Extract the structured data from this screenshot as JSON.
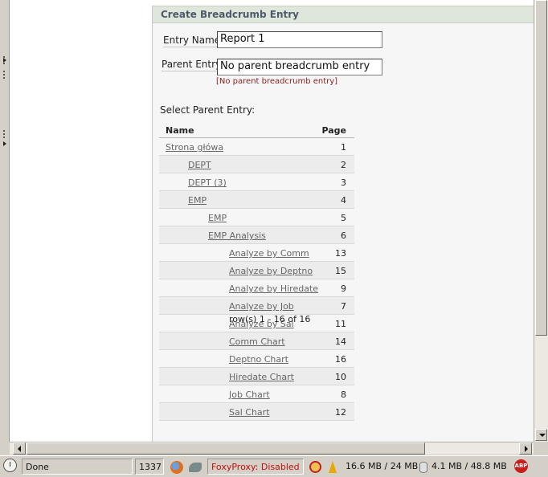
{
  "form": {
    "title": "Create Breadcrumb Entry",
    "entry_name": {
      "label": "Entry Name",
      "value": "Report 1"
    },
    "parent_entry": {
      "label": "Parent Entry",
      "value": "No parent breadcrumb entry",
      "note": "[No parent breadcrumb entry]"
    },
    "select_parent_label": "Select Parent Entry:"
  },
  "report": {
    "columns": [
      "Name",
      "Page"
    ],
    "rows": [
      {
        "name": "Strona główa",
        "page": "1",
        "level": 0
      },
      {
        "name": "DEPT",
        "page": "2",
        "level": 1
      },
      {
        "name": "DEPT (3)",
        "page": "3",
        "level": 1
      },
      {
        "name": "EMP",
        "page": "4",
        "level": 1
      },
      {
        "name": "EMP",
        "page": "5",
        "level": 2
      },
      {
        "name": "EMP Analysis",
        "page": "6",
        "level": 2
      },
      {
        "name": "Analyze by Comm",
        "page": "13",
        "level": 3
      },
      {
        "name": "Analyze by Deptno",
        "page": "15",
        "level": 3
      },
      {
        "name": "Analyze by Hiredate",
        "page": "9",
        "level": 3
      },
      {
        "name": "Analyze by Job",
        "page": "7",
        "level": 3
      },
      {
        "name": "Analyze by Sal",
        "page": "11",
        "level": 3
      },
      {
        "name": "Comm Chart",
        "page": "14",
        "level": 3
      },
      {
        "name": "Deptno Chart",
        "page": "16",
        "level": 3
      },
      {
        "name": "Hiredate Chart",
        "page": "10",
        "level": 3
      },
      {
        "name": "Job Chart",
        "page": "8",
        "level": 3
      },
      {
        "name": "Sal Chart",
        "page": "12",
        "level": 3
      }
    ],
    "pagination": "row(s) 1 - 16 of 16"
  },
  "statusbar": {
    "status": "Done",
    "number": "1337",
    "foxyproxy": "FoxyProxy: Disabled",
    "memory": "16.6 MB / 24 MB",
    "disk": "4.1 MB / 48.8 MB",
    "abp": "ABP",
    "icons": [
      "clock-icon",
      "firefox-icon",
      "shark-icon",
      "block-icon",
      "bolt-icon",
      "database-icon",
      "adblock-icon"
    ]
  },
  "colors": {
    "region_header": "#dfe6dc",
    "region_title": "#4e5a6a",
    "note": "#8b1c1c",
    "link": "#666666",
    "foxyproxy": "#c01010"
  }
}
